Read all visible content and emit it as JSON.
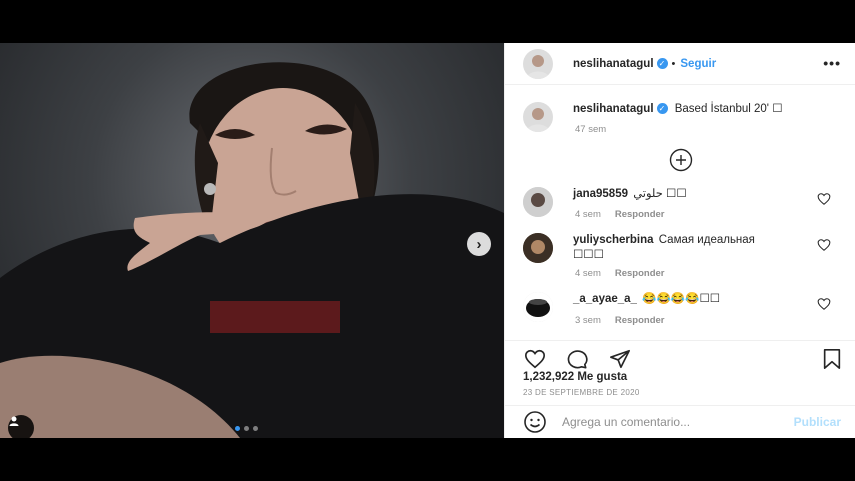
{
  "post": {
    "author": "neslihanatagul",
    "verified_mark": "✓",
    "follow_label": "Seguir",
    "more_label": "•••",
    "next_label": "›"
  },
  "caption": {
    "username": "neslihanatagul",
    "text": "Based İstanbul 20' ☐",
    "time": "47 sem"
  },
  "comments": [
    {
      "username": "jana95859",
      "text": "حلوتي ☐☐",
      "time": "4 sem",
      "reply": "Responder"
    },
    {
      "username": "yuliyscherbina",
      "text": "Самая идеальная ☐☐☐",
      "time": "4 sem",
      "reply": "Responder"
    },
    {
      "username": "_a_ayae_a_",
      "text": "😂😂😂😂☐☐",
      "time": "3 sem",
      "reply": "Responder"
    }
  ],
  "likes": "1,232,922 Me gusta",
  "date": "23 DE SEPTIEMBRE DE 2020",
  "comment_input": {
    "placeholder": "Agrega un comentario...",
    "publish_label": "Publicar"
  },
  "icons": [
    "heart-icon",
    "comment-icon",
    "share-icon",
    "bookmark-icon",
    "emoji-icon",
    "plus-circle-icon",
    "more-icon",
    "user-tag-icon",
    "chevron-right-icon"
  ],
  "colors": {
    "accent": "#3897f0",
    "publish_disabled": "#b2dffc",
    "text": "#262626",
    "muted": "#8e8e8e"
  }
}
